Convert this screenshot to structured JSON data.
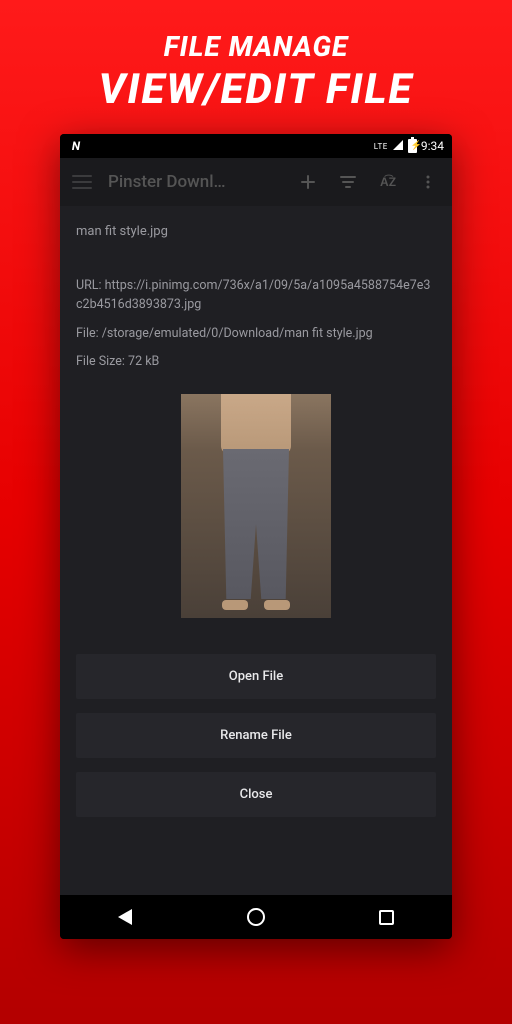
{
  "promo": {
    "title": "FILE MANAGE",
    "subtitle": "VIEW/EDIT FILE"
  },
  "statusbar": {
    "lte": "LTE",
    "time": "9:34"
  },
  "appbar": {
    "title": "Pinster Downl…",
    "sort": "A͡Z"
  },
  "file": {
    "name": "man fit style.jpg",
    "url_label": "URL: https://i.pinimg.com/736x/a1/09/5a/a1095a4588754e7e3c2b4516d3893873.jpg",
    "path_label": "File: /storage/emulated/0/Download/man fit style.jpg",
    "size_label": "File Size: 72 kB"
  },
  "buttons": {
    "open": "Open File",
    "rename": "Rename File",
    "close": "Close"
  }
}
